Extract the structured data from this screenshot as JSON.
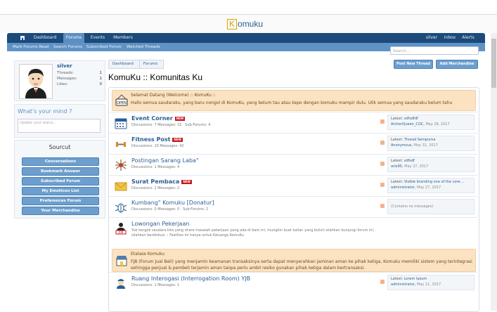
{
  "header": {
    "logo_k": "K",
    "logo_rest": "omuku"
  },
  "nav": {
    "tabs": [
      "Dashboard",
      "Forums",
      "Events",
      "Members"
    ],
    "active": "Forums",
    "user": "silver",
    "inbox": "Inbox",
    "alerts": "Alerts"
  },
  "subnav": {
    "items": [
      "Mark Forums Read",
      "Search Forums",
      "Subscribed Forum",
      "Watched Threads"
    ]
  },
  "search": {
    "placeholder": "Search..."
  },
  "profile": {
    "name": "silver",
    "stats": [
      {
        "label": "Threads:",
        "value": "1"
      },
      {
        "label": "Messages:",
        "value": "1"
      },
      {
        "label": "Likes:",
        "value": "0"
      }
    ]
  },
  "mind": {
    "title": "What's your mind ?",
    "placeholder": "Update your status..."
  },
  "sourcut": {
    "title": "Sourcut",
    "buttons": [
      "Conversations",
      "Bookmark Answer",
      "Subscribed Forum",
      "My Emoticon List",
      "Preferences Forum",
      "Your Merchandise"
    ]
  },
  "breadcrumb": [
    "Dashboard",
    "Forums"
  ],
  "actions": {
    "post": "Post New Thread",
    "merch": "Add Merchandise"
  },
  "page_title": "KomuKu :: Komunitas Ku",
  "categories": [
    {
      "title": "Selamat Datang (Welcome) :: KomuKu ::",
      "desc": "Hallo semua saudaraku, yang baru nongol di KomuKu, yang belum tau atau kepo dengan komuku mampir dulu. Ulik semua yang saudaraku belum tahu",
      "icon": "open-sign-icon"
    },
    {
      "title": "Etalase Komuku",
      "desc": "FJB (Forum Jual Beli) yang menjamin keamanan transaksinya serta dapat menyerahkan jaminan aman ke pihak ketiga, Komuku memiliki sistem yang terintegrasi sehingga penjual & pembeli terjamin aman tanpa perlu ambil resiko gunakan pihak ketiga dalam bertransaksi.",
      "icon": "store-icon"
    }
  ],
  "forums": [
    {
      "name": "Event Corner",
      "new": "NEW",
      "meta": "Discussions: 7 Messages: 32 · Sub-Forums: 4",
      "latest_label": "Latest:",
      "latest_title": "sdfsdfdf",
      "latest_by": "ArcherQueen_COC,",
      "latest_date": "May 28, 2017",
      "icon": "calendar-icon"
    },
    {
      "name": "Fitness Post",
      "new": "NEW",
      "meta": "Discussions: 10 Messages: 42",
      "latest_label": "Latest:",
      "latest_title": "Thread Sempurna",
      "latest_by": "Anonymous,",
      "latest_date": "May 31, 2017",
      "icon": "dumbbell-icon"
    },
    {
      "name": "Postingan Sarang Laba\"",
      "new": "",
      "meta": "Discussions: 1 Messages: 4",
      "latest_label": "Latest:",
      "latest_title": "sdfsdf",
      "latest_by": "arie95,",
      "latest_date": "May 27, 2017",
      "icon": "spider-icon"
    },
    {
      "name": "Surat Pembaca",
      "new": "NEW",
      "meta": "Discussions: 2 Messages: 2",
      "latest_label": "Latest:",
      "latest_title": "Visible branding one of the core ...",
      "latest_by": "administrator,",
      "latest_date": "May 27, 2017",
      "icon": "envelope-icon"
    },
    {
      "name": "Kumbang\" Komuku [Donatur]",
      "new": "",
      "meta": "Discussions: 0 Messages: 0 · Sub-Forums: 2",
      "latest_empty": "(Contains no messages)",
      "icon": "beetle-icon"
    },
    {
      "name": "Lowongan Pekerjaan",
      "new": "",
      "meta": "Yuk tengok saudara kita yang share masalah pekerjaan yang ada di bam ini, mungkin buat kalian yang butuh silahkan kunjungi forum ini, silahkan berdiskusi :: Fasilitas ini hanya untuk Keluarga KomuKu",
      "icon": "job-icon"
    },
    {
      "name": "Ruang Interogasi (Interrogation Room) YJB",
      "new": "",
      "meta": "Discussions: 1 Messages: 1",
      "latest_label": "Latest:",
      "latest_title": "Lorem Ipsum",
      "latest_by": "administrator,",
      "latest_date": "May 11, 2017",
      "icon": "police-icon"
    }
  ]
}
